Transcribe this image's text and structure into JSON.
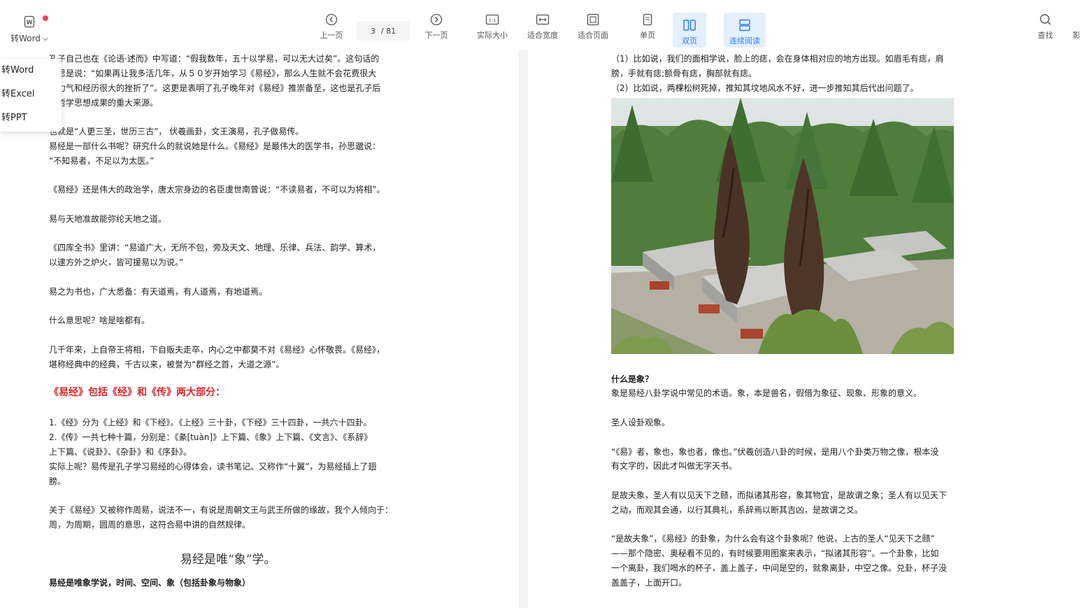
{
  "toolbar": {
    "convert_word": "转Word",
    "prev_page": "上一页",
    "page_current": "3",
    "page_total": "/ 81",
    "next_page": "下一页",
    "actual_size": "实际大小",
    "fit_width": "适合宽度",
    "fit_page": "适合页面",
    "single_page": "单页",
    "double_page": "双页",
    "continuous": "连续阅读",
    "search": "查找",
    "more": "影"
  },
  "menu": {
    "items": [
      "转Word",
      "转Excel",
      "转PPT"
    ]
  },
  "left_page": {
    "lines": [
      "孔子自己也在《论语·述而》中写道：“假我数年，五十以学易，可以无大过矣”。这句话的",
      "意思是说：“如果再让我多活几年，从５０岁开始学习《易经》，那么人生就不会花费很大",
      "的力气和经历很大的挫折了”。这更是表明了孔子晚年对《易经》推崇备至，这也是孔子后",
      "来哲学思想成果的重大来源。",
      "也就是“人更三圣，世历三古”， 伏羲画卦，文王演易，孔子做易传。",
      "易经是一部什么书呢？研究什么的就说她是什么。《易经》是最伟大的医学书，孙思邈说：",
      "“不知易者，不足以为太医。”",
      "《易经》还是伟大的政治学，唐太宗身边的名臣虞世南曾说：“不读易者，不可以为将相”。",
      "易与天地准故能弥纶天地之道。",
      "《四库全书》里讲：“易道广大，无所不包，旁及天文、地理、乐律、兵法、韵学、算术，",
      "以逮方外之炉火，皆可援易以为说。”",
      "易之为书也，广大悉备：有天道焉，有人道焉，有地道焉。",
      "什么意思呢？啥是啥都有。",
      "几千年来，上自帝王将相，下自贩夫走卒，内心之中都莫不对《易经》心怀敬畏。《易经》，",
      "堪称经典中的经典，千古以来，被誉为“群经之首，大道之源”。",
      "《易经》包括《经》和《传》两大部分：",
      "1.《经》分为《上经》和《下经》。《上经》三十卦，《下经》三十四卦，一共六十四卦。",
      "2.《传》一共七种十篇，分别是：《彖[tuàn]》上下篇、《象》上下篇、《文言》、《系辞》",
      "上下篇、《说卦》、《杂卦》和《序卦》。",
      "实际上呢？易传是孔子学习易经的心得体会，读书笔记。又称作“十翼”，为易经插上了翅",
      "膀。",
      "关于《易经》又被称作周易，说法不一，有说是周朝文王与武王所做的缘故，我个人倾向于：",
      "周，为周期，圆周的意思，这符合易中讲的自然规律。",
      "易经是唯“象”学。",
      "易经是唯象学说，时间、空间、象（包括卦象与物象）"
    ]
  },
  "right_page": {
    "lines": [
      "（1）比如说，我们的面相学说，脸上的痣，会在身体相对应的地方出现。如眉毛有痣，肩",
      "膀，手就有痣;额骨有痣，胸部就有痣。",
      "（2）比如说，两棵松树死掉，推知其坟地风水不好，进一步推知其后代出问题了。",
      "什么是象？",
      "象是易经八卦学说中常见的术语。象，本是兽名，假借为象征、现象、形象的意义。",
      "圣人设卦观象。",
      "“《易》者，象也，象也者，像也。”伏羲创造八卦的时候，是用八个卦类万物之像，根本没",
      "有文字的，因此才叫做无字天书。",
      "是故夫象，圣人有以见天下之赜，而拟诸其形容，象其物宜，是故谓之象；圣人有以见天下",
      "之动，而观其会通，以行其典礼，系辞焉以断其吉凶，是故谓之爻。",
      "“是故夫象”，《易经》的卦象，为什么会有这个卦象呢？他说，上古的圣人“见天下之赜”",
      "——那个隐密、奥秘看不见的，有时候要用图案来表示，“拟诸其形容”。一个卦象，比如",
      "一个离卦，我们喝水的杯子，盖上盖子，中间是空的，就象离卦，中空之像。兑卦，杯子没",
      "盖盖子，上面开口。"
    ]
  },
  "colors": {
    "accent": "#2f7bf5",
    "active_bg": "#e4efff",
    "red_heading": "#e0272a",
    "notify_dot": "#f0405a"
  },
  "icons": [
    "word-file-icon",
    "chevron-down-icon",
    "prev-page-icon",
    "next-page-icon",
    "actual-size-icon",
    "fit-width-icon",
    "fit-page-icon",
    "single-page-icon",
    "double-page-icon",
    "continuous-read-icon",
    "search-icon"
  ]
}
